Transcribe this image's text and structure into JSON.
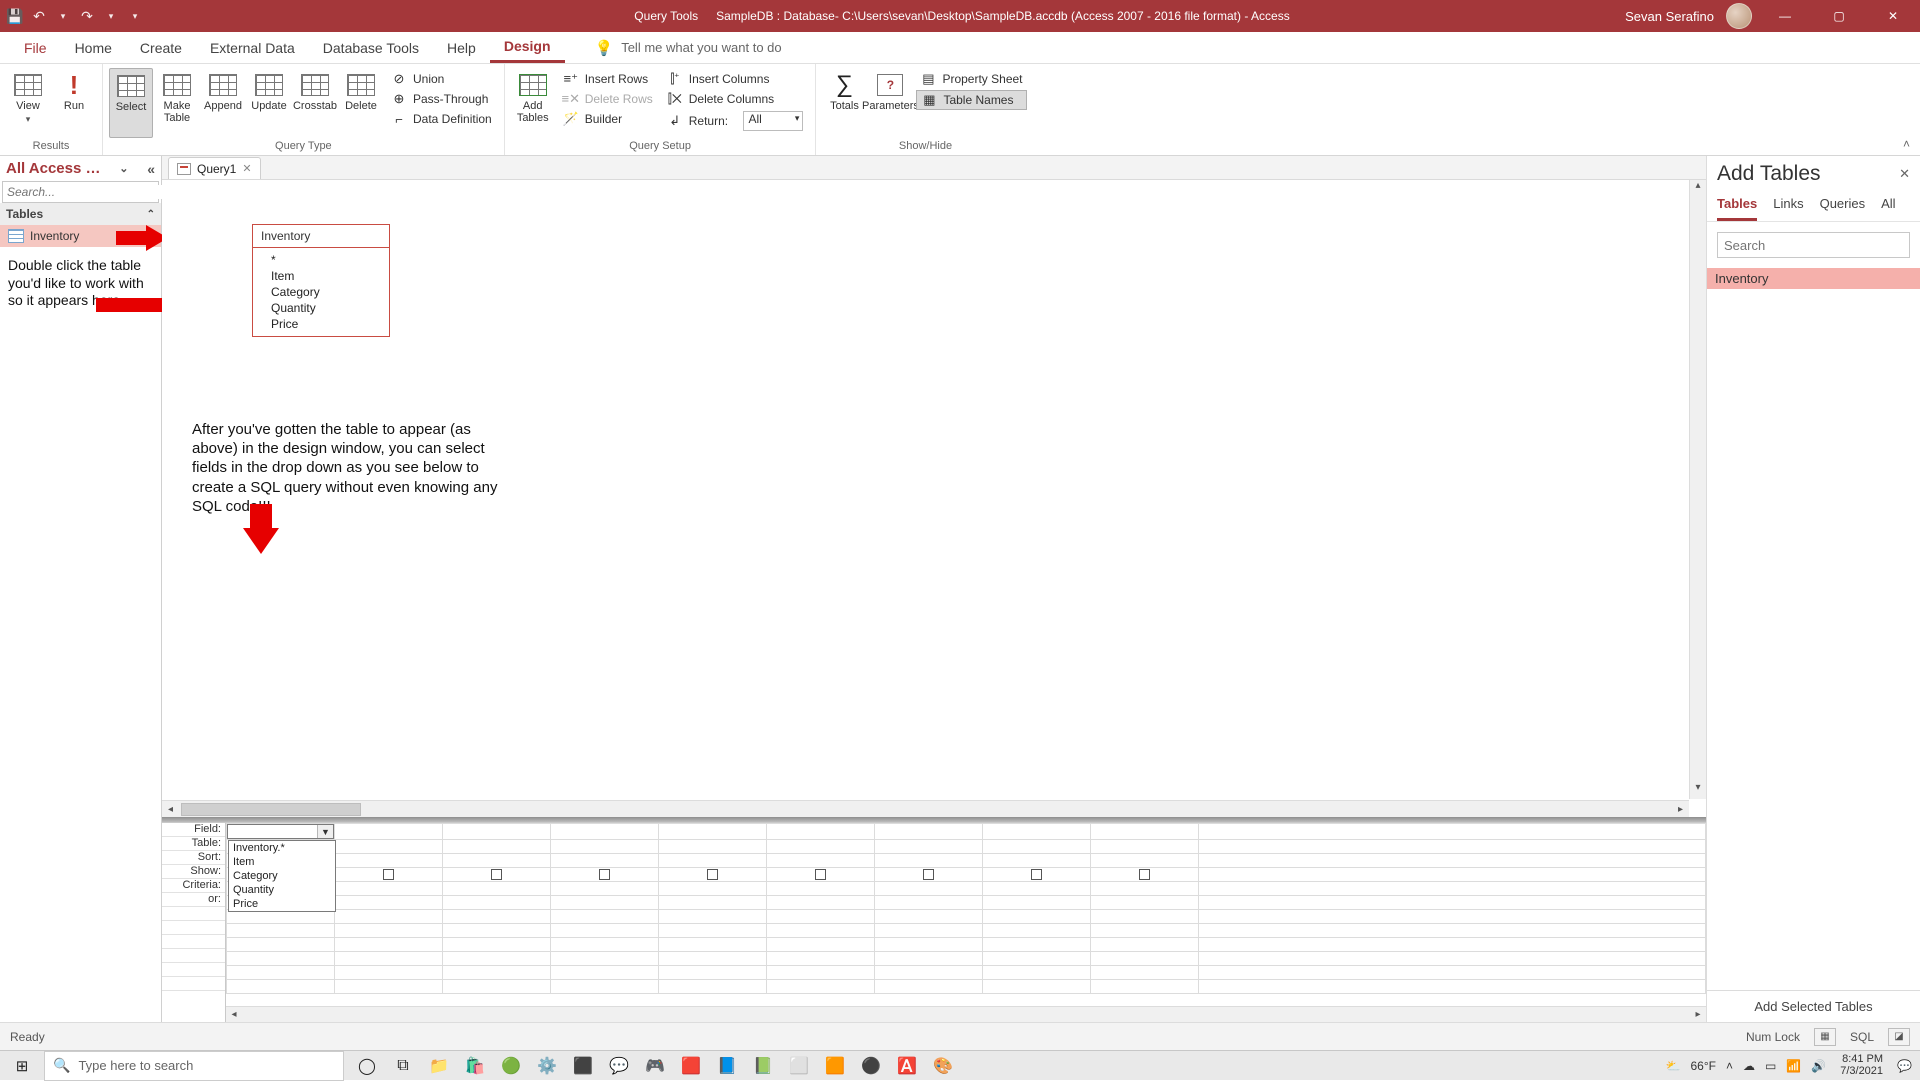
{
  "titlebar": {
    "context_tab": "Query Tools",
    "title": "SampleDB : Database- C:\\Users\\sevan\\Desktop\\SampleDB.accdb (Access 2007 - 2016 file format)  -  Access",
    "user": "Sevan Serafino"
  },
  "ribbon_tabs": {
    "file": "File",
    "items": [
      "Home",
      "Create",
      "External Data",
      "Database Tools",
      "Help",
      "Design"
    ],
    "active": "Design",
    "tell_me": "Tell me what you want to do"
  },
  "ribbon": {
    "results": {
      "label": "Results",
      "view": "View",
      "run": "Run"
    },
    "query_type": {
      "label": "Query Type",
      "select": "Select",
      "make": "Make\nTable",
      "append": "Append",
      "update": "Update",
      "crosstab": "Crosstab",
      "delete": "Delete",
      "union": "Union",
      "passthrough": "Pass-Through",
      "datadef": "Data Definition"
    },
    "query_setup": {
      "label": "Query Setup",
      "add_tables": "Add\nTables",
      "insert_rows": "Insert Rows",
      "delete_rows": "Delete Rows",
      "builder": "Builder",
      "insert_cols": "Insert Columns",
      "delete_cols": "Delete Columns",
      "return_lbl": "Return:",
      "return_val": "All"
    },
    "show_hide": {
      "label": "Show/Hide",
      "totals": "Totals",
      "parameters": "Parameters",
      "property_sheet": "Property Sheet",
      "table_names": "Table Names"
    }
  },
  "navpane": {
    "header": "All Access …",
    "search_placeholder": "Search...",
    "group": "Tables",
    "object": "Inventory",
    "annotation": "Double click the table you'd like to work with so it appears here"
  },
  "doc": {
    "tab": "Query1"
  },
  "tablecard": {
    "name": "Inventory",
    "fields": [
      "*",
      "Item",
      "Category",
      "Quantity",
      "Price"
    ]
  },
  "annotation2": "After you've gotten the table to appear (as above) in the design window, you can select fields in the drop down as you see below to create a SQL query without even knowing any SQL code!!!",
  "qbe": {
    "rows": [
      "Field:",
      "Table:",
      "Sort:",
      "Show:",
      "Criteria:",
      "or:"
    ],
    "dropdown": [
      "Inventory.*",
      "Item",
      "Category",
      "Quantity",
      "Price"
    ]
  },
  "addpane": {
    "title": "Add Tables",
    "tabs": [
      "Tables",
      "Links",
      "Queries",
      "All"
    ],
    "active": "Tables",
    "search_placeholder": "Search",
    "items": [
      "Inventory"
    ],
    "footer": "Add Selected Tables"
  },
  "statusbar": {
    "left": "Ready",
    "numlock": "Num Lock",
    "sql": "SQL"
  },
  "taskbar": {
    "search_placeholder": "Type here to search",
    "weather": "66°F",
    "time": "8:41 PM",
    "date": "7/3/2021"
  }
}
